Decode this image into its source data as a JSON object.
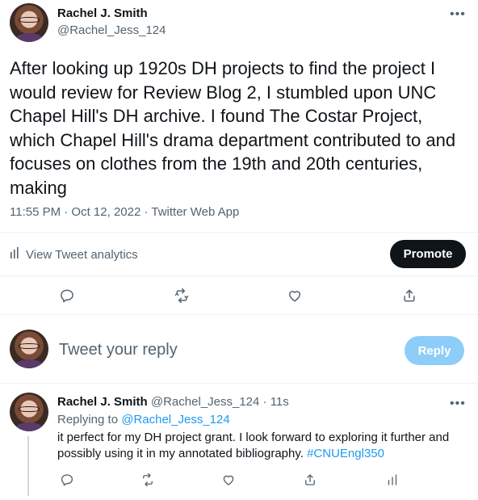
{
  "tweet": {
    "author_name": "Rachel J. Smith",
    "author_handle": "@Rachel_Jess_124",
    "more_label": "•••",
    "text": "After looking up 1920s DH projects to find the project I would review for Review Blog 2, I stumbled upon UNC Chapel Hill's DH archive. I found The Costar Project, which Chapel Hill's drama department contributed to and focuses on clothes from the 19th and 20th centuries, making",
    "timestamp": "11:55 PM · Oct 12, 2022 · Twitter Web App",
    "analytics_label": "View Tweet analytics",
    "promote_label": "Promote",
    "action_icons": [
      "reply-icon",
      "retweet-icon",
      "like-icon",
      "share-icon"
    ]
  },
  "composer": {
    "placeholder": "Tweet your reply",
    "reply_button_label": "Reply"
  },
  "reply_tweet": {
    "author_name": "Rachel J. Smith",
    "author_handle": "@Rachel_Jess_124",
    "separator": " · ",
    "time": "11s",
    "more_label": "•••",
    "replying_to_label": "Replying to",
    "replying_to_handle": "@Rachel_Jess_124",
    "text": "it perfect for my DH project grant. I look forward to exploring it further and possibly using it in my annotated bibliography.",
    "hashtag": "#CNUEngl350",
    "action_icons": [
      "reply-icon",
      "retweet-icon",
      "like-icon",
      "share-icon",
      "analytics-icon"
    ]
  },
  "colors": {
    "text_primary": "#0f1419",
    "text_secondary": "#536471",
    "link": "#1d9bf0",
    "promote_bg": "#0f1419",
    "reply_button_bg": "#8ecdf8"
  }
}
